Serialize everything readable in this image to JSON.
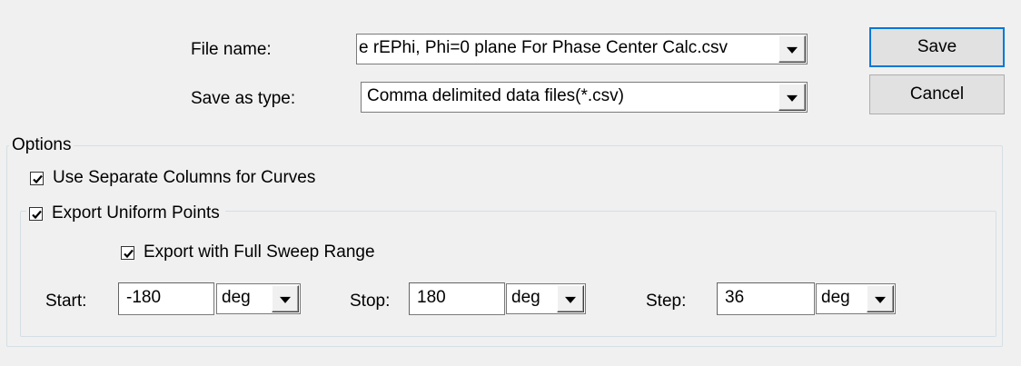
{
  "file_name": {
    "label": "File name:",
    "value": "e rEPhi, Phi=0 plane For Phase Center Calc.csv"
  },
  "save_as_type": {
    "label": "Save as type:",
    "value": "Comma delimited data files(*.csv)"
  },
  "buttons": {
    "save": "Save",
    "cancel": "Cancel"
  },
  "options": {
    "title": "Options",
    "separate_columns": {
      "label": "Use Separate Columns for Curves",
      "checked": true
    },
    "uniform_points": {
      "label": "Export Uniform Points",
      "checked": true,
      "full_sweep": {
        "label": "Export with Full Sweep Range",
        "checked": true
      },
      "start": {
        "label": "Start:",
        "value": "-180",
        "unit": "deg"
      },
      "stop": {
        "label": "Stop:",
        "value": "180",
        "unit": "deg"
      },
      "step": {
        "label": "Step:",
        "value": "36",
        "unit": "deg"
      }
    }
  },
  "colors": {
    "window_bg": "#f0f0f0",
    "default_button_border": "#0078d7",
    "groupbox_border": "#d5dfe5"
  }
}
